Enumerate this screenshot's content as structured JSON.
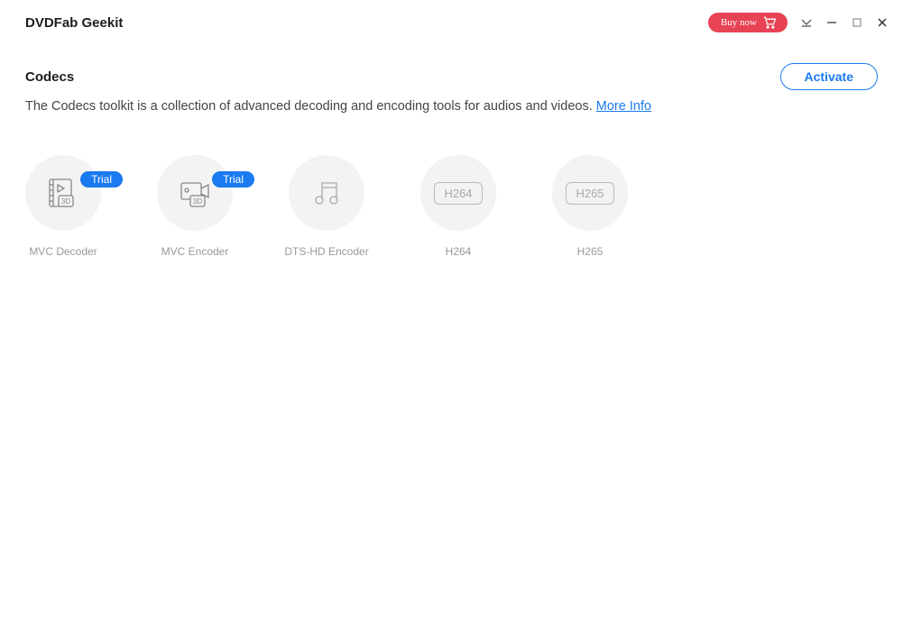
{
  "titlebar": {
    "app_title": "DVDFab Geekit",
    "buy_now": "Buy now"
  },
  "section": {
    "title": "Codecs",
    "activate": "Activate",
    "description_prefix": "The Codecs toolkit is a collection of advanced decoding and encoding tools for audios and videos. ",
    "more_info": "More Info"
  },
  "badges": {
    "trial": "Trial"
  },
  "tools": [
    {
      "label": "MVC Decoder",
      "badge": "trial"
    },
    {
      "label": "MVC Encoder",
      "badge": "trial"
    },
    {
      "label": "DTS-HD Encoder"
    },
    {
      "label": "H264",
      "box_text": "H264"
    },
    {
      "label": "H265",
      "box_text": "H265"
    }
  ]
}
